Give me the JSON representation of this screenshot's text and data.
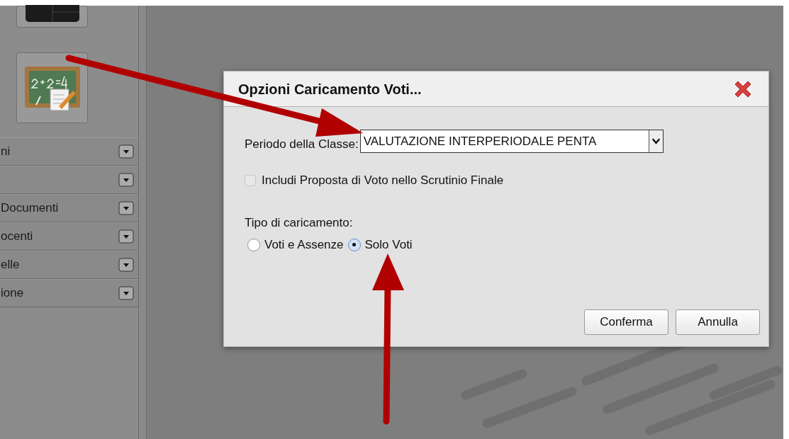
{
  "sidebar": {
    "tiles": [
      {
        "kind": "monitor"
      },
      {
        "kind": "chalkboard"
      }
    ],
    "sections": [
      {
        "label": "ni",
        "expanded": false
      },
      {
        "expanded": false
      },
      {
        "label": "Documenti",
        "expanded": false
      },
      {
        "label": "ocenti",
        "expanded": false
      },
      {
        "label": "elle",
        "expanded": false
      },
      {
        "label": "ione",
        "expanded": false
      }
    ]
  },
  "dialog": {
    "title": "Opzioni Caricamento Voti...",
    "period": {
      "label": "Periodo della Classe:",
      "value": "VALUTAZIONE INTERPERIODALE PENTA"
    },
    "checkbox": {
      "label": "Includi Proposta di Voto nello Scrutinio Finale",
      "checked": false,
      "disabled": true
    },
    "load_type": {
      "label": "Tipo di caricamento:",
      "options": [
        {
          "label": "Voti e Assenze",
          "selected": false
        },
        {
          "label": "Solo Voti",
          "selected": true
        }
      ]
    },
    "buttons": [
      "Conferma",
      "Annulla"
    ]
  }
}
